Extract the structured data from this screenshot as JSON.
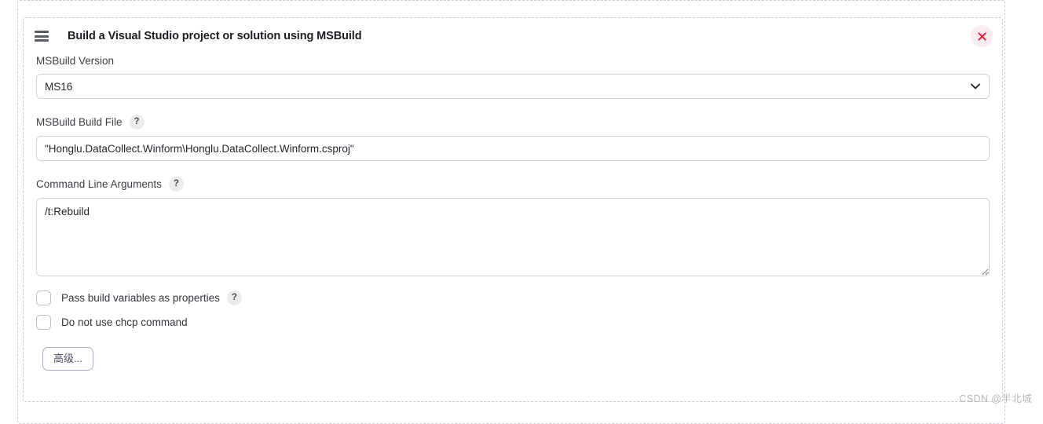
{
  "card": {
    "drag_handle_icon": "hamburger-drag-icon",
    "title": "Build a Visual Studio project or solution using MSBuild",
    "close_icon": "close-x-icon"
  },
  "fields": {
    "msbuild_version": {
      "label": "MSBuild Version",
      "value": "MS16",
      "options": [
        "MS16"
      ],
      "chevron_icon": "chevron-down-icon"
    },
    "build_file": {
      "label": "MSBuild Build File",
      "help": "?",
      "value": "\"Honglu.DataCollect.Winform\\Honglu.DataCollect.Winform.csproj\"",
      "placeholder": ""
    },
    "command_line_arguments": {
      "label": "Command Line Arguments",
      "help": "?",
      "value": "/t:Rebuild",
      "placeholder": ""
    }
  },
  "checkboxes": [
    {
      "label": "Pass build variables as properties",
      "checked": false,
      "help": "?"
    },
    {
      "label": "Do not use chcp command",
      "checked": false,
      "help": null
    }
  ],
  "buttons": {
    "advanced": "高级..."
  },
  "watermark": "CSDN @半北城",
  "colors": {
    "close_bg": "#fbeaee",
    "close_fg": "#f0173d",
    "border": "#ced4da",
    "dashed": "#c9ccd2",
    "text": "#24282e"
  }
}
